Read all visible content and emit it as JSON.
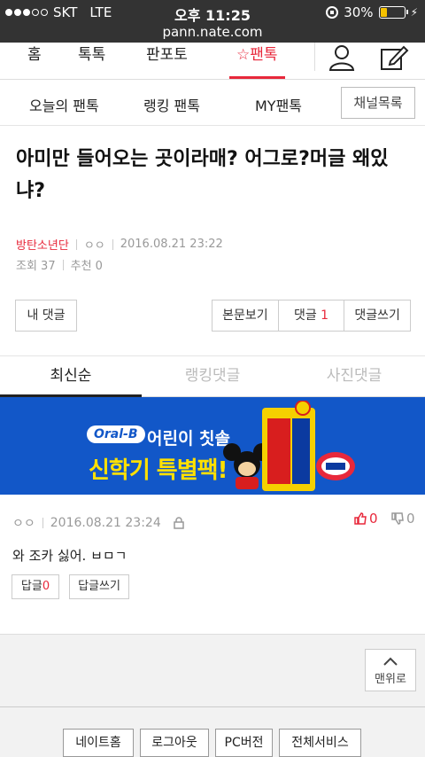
{
  "status_bar": {
    "carrier": "SKT",
    "network": "LTE",
    "time": "오후 11:25",
    "battery_percent": "30%",
    "battery_level": 0.3
  },
  "url": "pann.nate.com",
  "gnb": {
    "items": [
      "홈",
      "톡톡",
      "판포토",
      "팬톡"
    ],
    "active_index": 3
  },
  "subnav": {
    "items": [
      "오늘의 팬톡",
      "랭킹 팬톡",
      "MY팬톡"
    ],
    "channel_button": "채널목록"
  },
  "article": {
    "title": "아미만 들어오는 곳이라매? 어그로?머글 왜있냐?",
    "author": "방탄소년단",
    "writer": "ㅇㅇ",
    "datetime": "2016.08.21 23:22",
    "views_label": "조회 37",
    "recommend_label": "추천 0"
  },
  "actions": {
    "my_comments": "내 댓글",
    "view_body": "본문보기",
    "comments_label": "댓글",
    "comments_count": "1",
    "write_comment": "댓글쓰기"
  },
  "comment_tabs": [
    "최신순",
    "랭킹댓글",
    "사진댓글"
  ],
  "banner": {
    "brand": "Oral-B",
    "line1": "어린이 칫솔",
    "line2": "신학기 특별팩!"
  },
  "comment": {
    "writer": "ㅇㅇ",
    "datetime": "2016.08.21 23:24",
    "likes": "0",
    "dislikes": "0",
    "body": "와 조카 싫어. ㅂㅁㄱ",
    "reply_label": "답글",
    "reply_count": "0",
    "write_reply": "답글쓰기"
  },
  "top_button": "맨위로",
  "footer": [
    "네이트홈",
    "로그아웃",
    "PC버전",
    "전체서비스"
  ],
  "colors": {
    "accent": "#e8283b",
    "banner_bg": "#1257c8",
    "banner_text": "#ffe000"
  }
}
